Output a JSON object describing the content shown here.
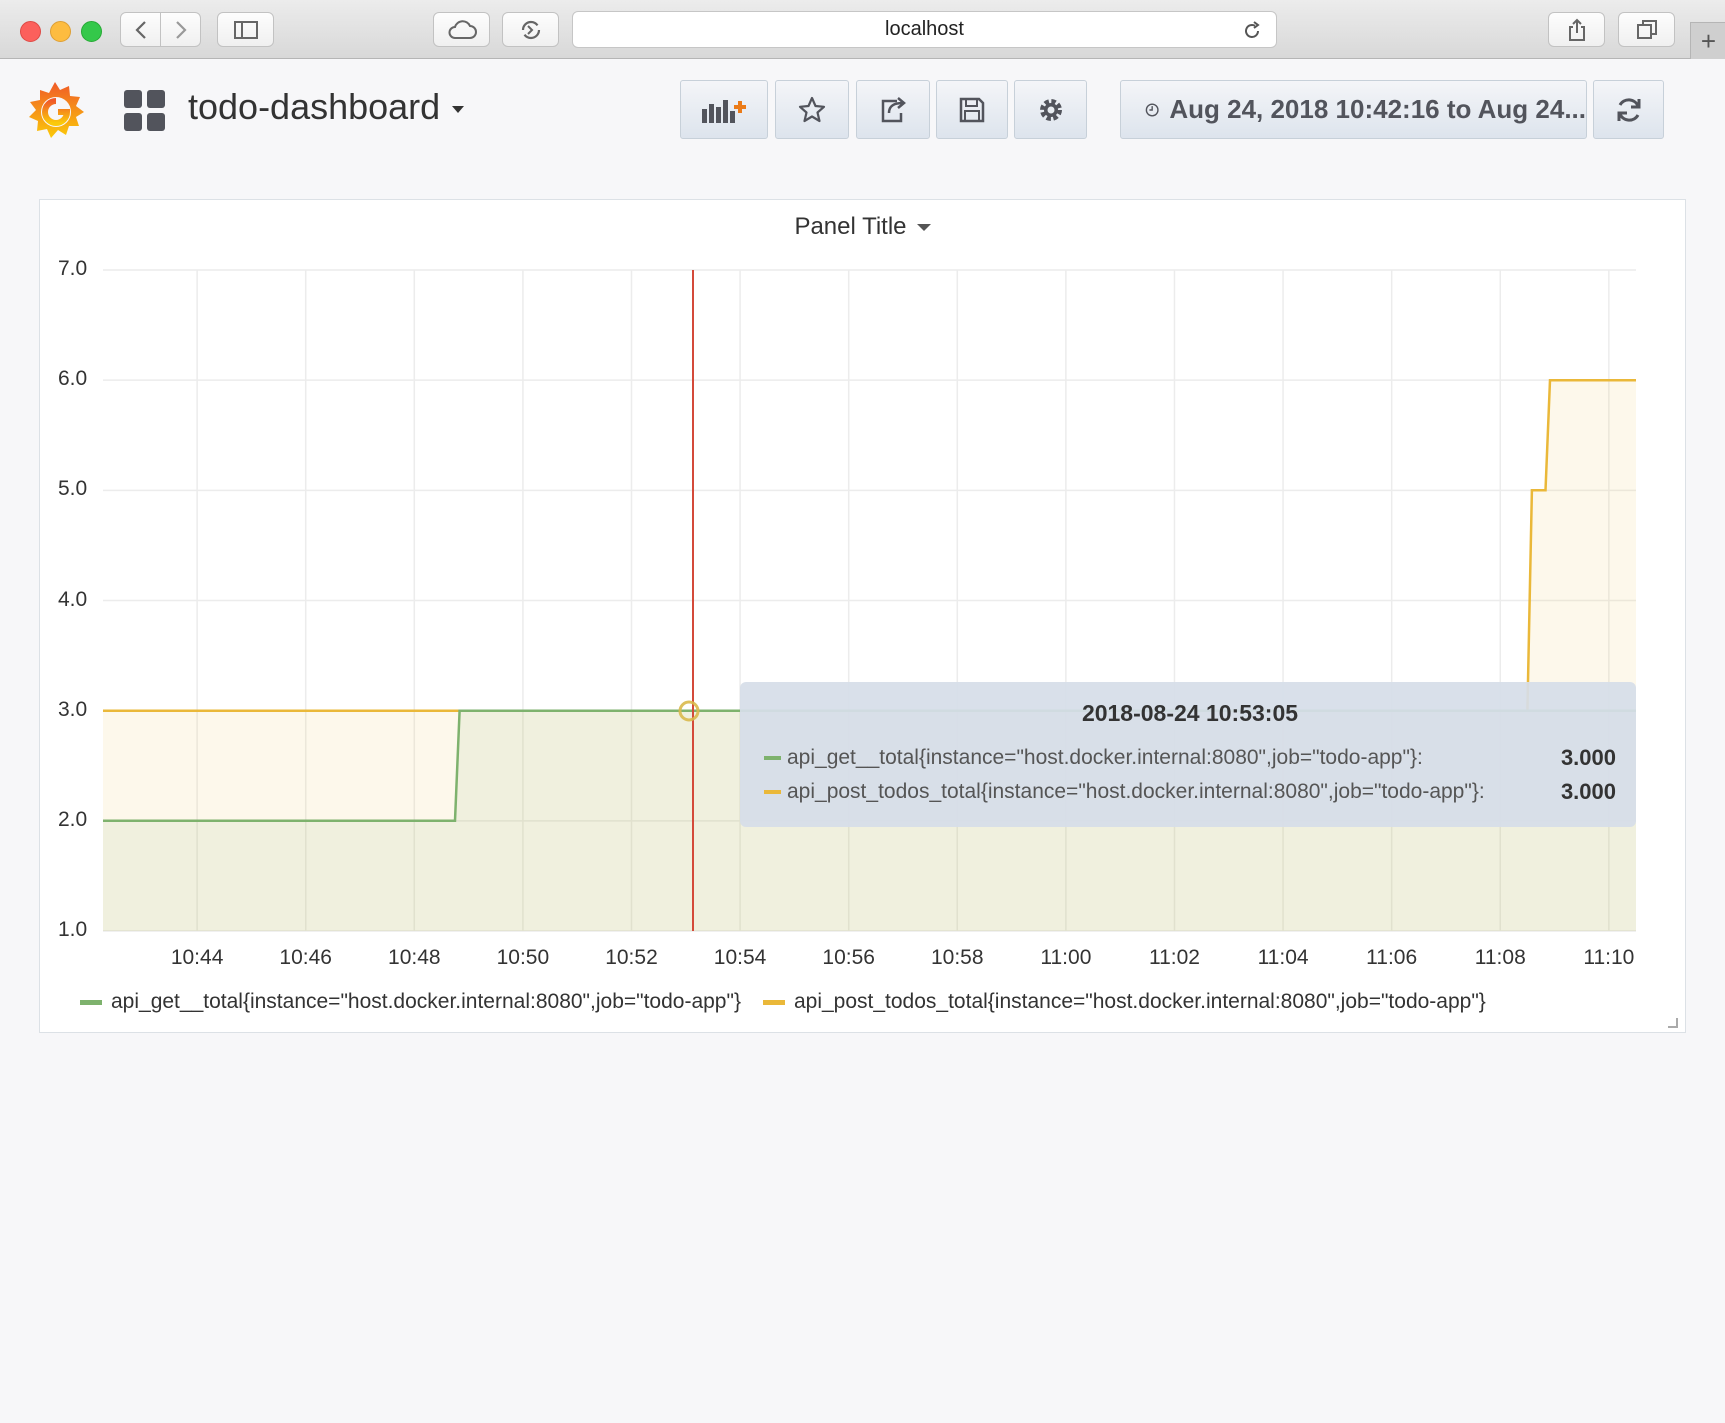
{
  "browser": {
    "url": "localhost",
    "icons": [
      "back-icon",
      "forward-icon",
      "sidebar-icon",
      "cloud-icon",
      "sync-icon",
      "reload-icon",
      "share-icon",
      "tabs-icon",
      "plus-icon"
    ]
  },
  "header": {
    "dashboard_title": "todo-dashboard",
    "time_range": "Aug 24, 2018 10:42:16 to Aug 24...",
    "icons": [
      "grafana-logo",
      "dashboards-grid-icon",
      "add-panel-icon",
      "star-icon",
      "share-icon",
      "save-icon",
      "settings-icon",
      "clock-icon",
      "refresh-icon"
    ]
  },
  "panel": {
    "title": "Panel Title"
  },
  "colors": {
    "green": "#7eb26d",
    "yellow": "#eab839",
    "crosshair": "#d44a3a"
  },
  "chart_data": {
    "type": "line",
    "title": "Panel Title",
    "xlabel": "",
    "ylabel": "",
    "ylim": [
      1.0,
      7.0
    ],
    "y_ticks": [
      "7.0",
      "6.0",
      "5.0",
      "4.0",
      "3.0",
      "2.0",
      "1.0"
    ],
    "x_ticks": [
      "10:44",
      "10:46",
      "10:48",
      "10:50",
      "10:52",
      "10:54",
      "10:56",
      "10:58",
      "11:00",
      "11:02",
      "11:04",
      "11:06",
      "11:08",
      "11:10"
    ],
    "grid": true,
    "legend": "bottom",
    "series": [
      {
        "name": "api_get__total{instance=\"host.docker.internal:8080\",job=\"todo-app\"}",
        "color": "#7eb26d",
        "x": [
          "10:42:16",
          "10:48:45",
          "10:48:50",
          "11:10:30"
        ],
        "values": [
          2,
          2,
          3,
          3
        ]
      },
      {
        "name": "api_post_todos_total{instance=\"host.docker.internal:8080\",job=\"todo-app\"}",
        "color": "#eab839",
        "x": [
          "10:42:16",
          "11:08:30",
          "11:08:35",
          "11:08:50",
          "11:08:55",
          "11:10:30"
        ],
        "values": [
          3,
          3,
          5,
          5,
          6,
          6
        ]
      }
    ],
    "tooltip": {
      "time": "2018-08-24 10:53:05",
      "rows": [
        {
          "name": "api_get__total{instance=\"host.docker.internal:8080\",job=\"todo-app\"}:",
          "value": "3.000",
          "color": "#7eb26d"
        },
        {
          "name": "api_post_todos_total{instance=\"host.docker.internal:8080\",job=\"todo-app\"}:",
          "value": "3.000",
          "color": "#eab839"
        }
      ]
    }
  }
}
